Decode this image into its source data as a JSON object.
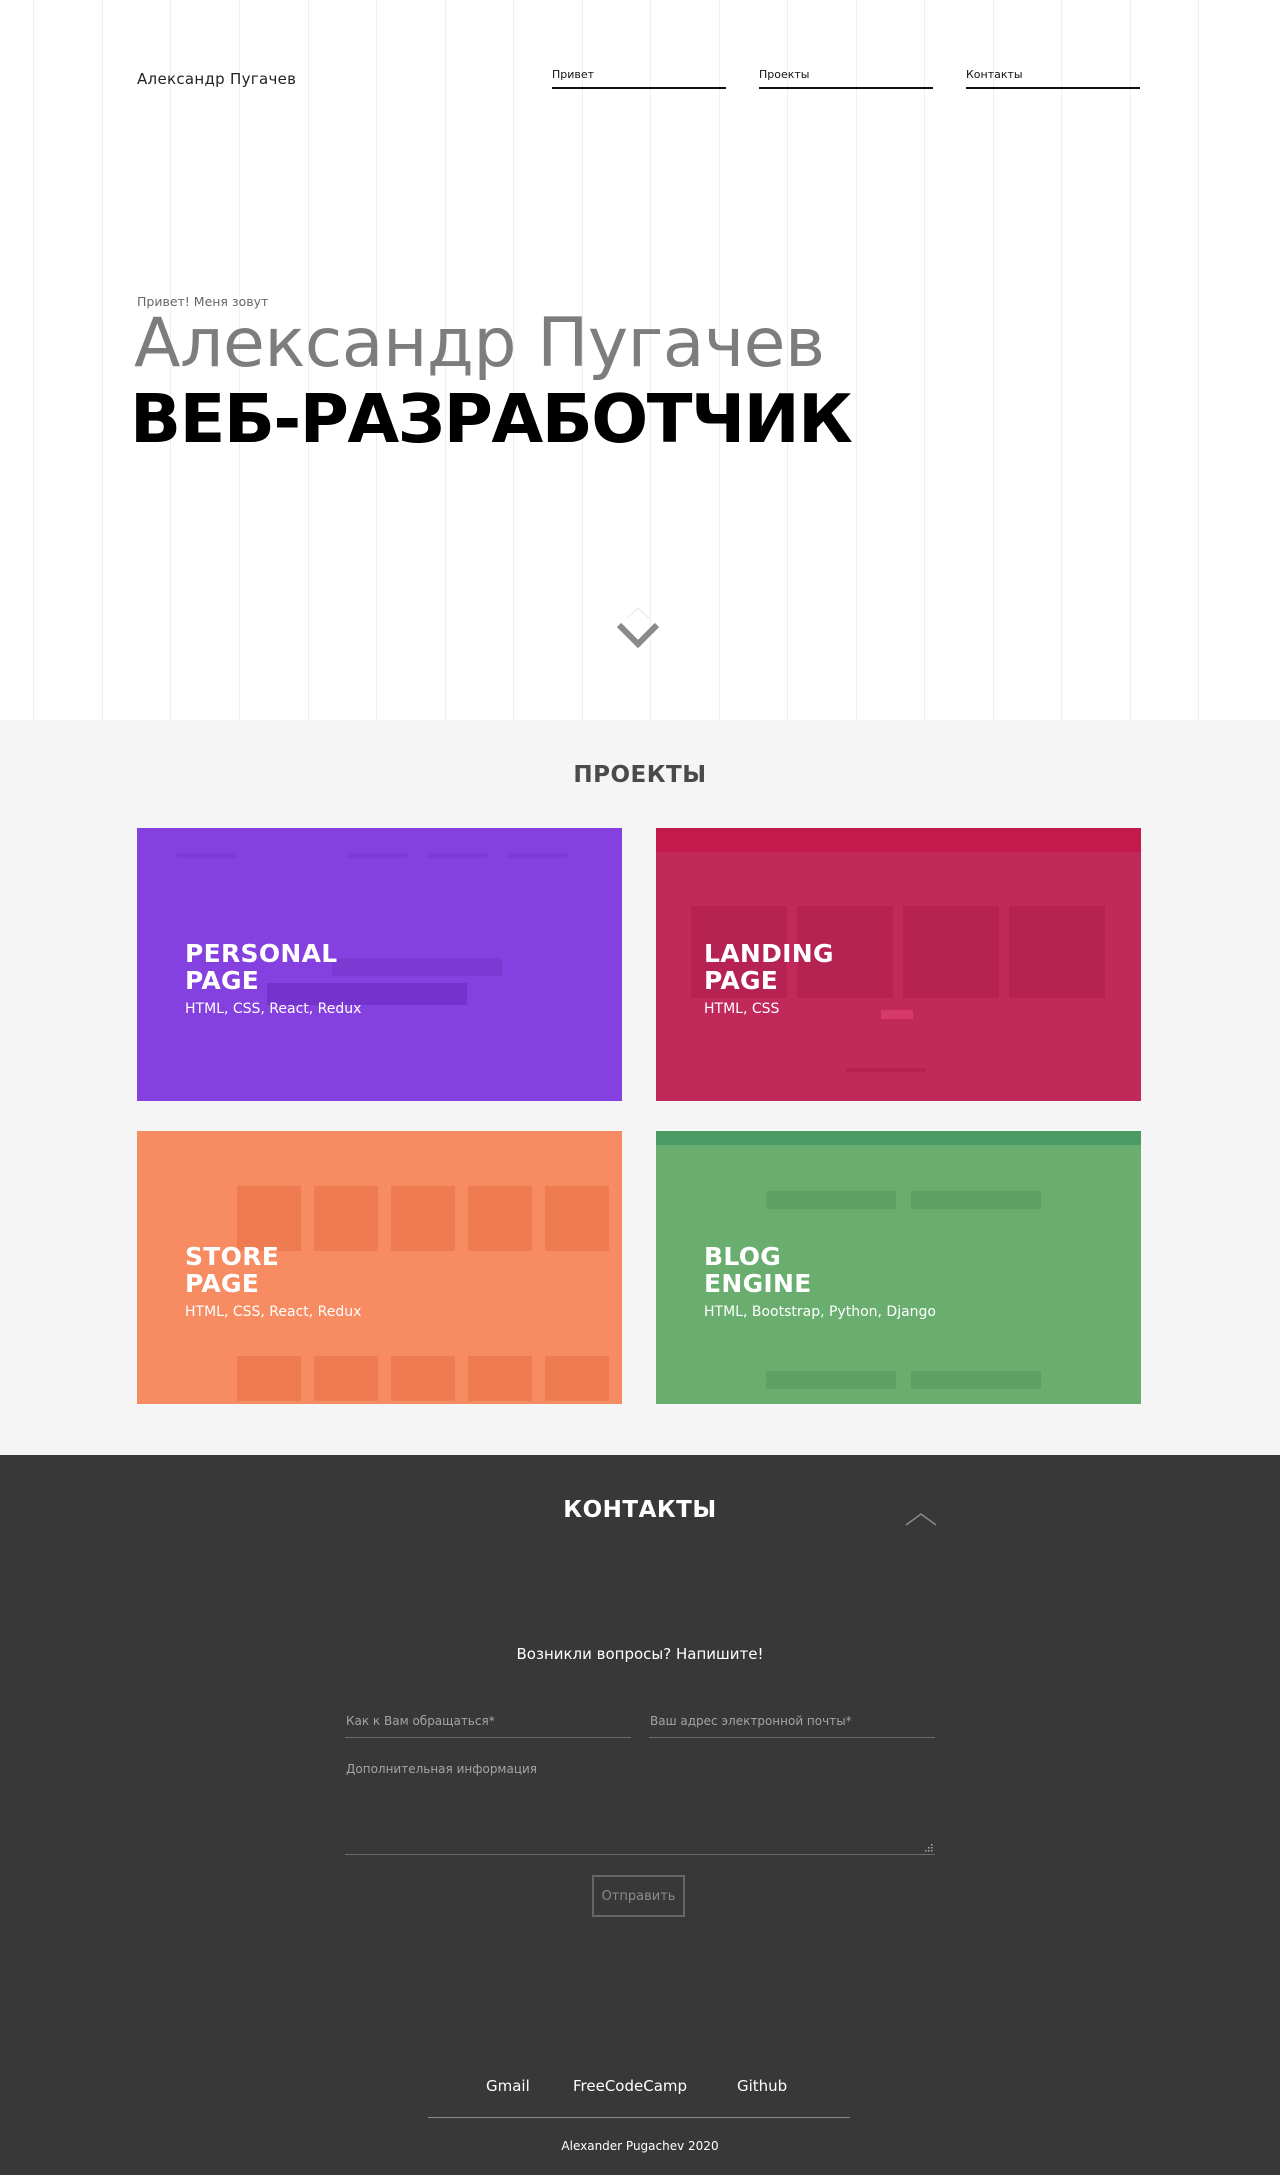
{
  "header": {
    "site_name": "Александр Пугачев",
    "nav": [
      {
        "label": "Привет"
      },
      {
        "label": "Проекты"
      },
      {
        "label": "Контакты"
      }
    ]
  },
  "hero": {
    "greeting": "Привет! Меня зовут",
    "name": "Александр Пугачев",
    "role": "ВЕБ-РАЗРАБОТЧИК",
    "scroll_icon": "chevron-down-icon"
  },
  "projects": {
    "title": "ПРОЕКТЫ",
    "items": [
      {
        "title_line1": "PERSONAL",
        "title_line2": "PAGE",
        "tech": "HTML, CSS, React, Redux",
        "color": "#8540e0"
      },
      {
        "title_line1": "LANDING",
        "title_line2": "PAGE",
        "tech": "HTML, CSS",
        "color": "#c0295a"
      },
      {
        "title_line1": "STORE",
        "title_line2": "PAGE",
        "tech": "HTML, CSS, React, Redux",
        "color": "#f78c62"
      },
      {
        "title_line1": "BLOG",
        "title_line2": "ENGINE",
        "tech": "HTML, Bootstrap, Python, Django",
        "color": "#69ae6e"
      }
    ]
  },
  "contacts": {
    "title": "КОНТАКТЫ",
    "scroll_up_icon": "chevron-up-icon",
    "prompt": "Возникли вопросы? Напишите!",
    "form": {
      "name_placeholder": "Как к Вам обращаться*",
      "email_placeholder": "Ваш адрес электронной почты*",
      "info_placeholder": "Дополнительная информация",
      "submit_label": "Отправить"
    }
  },
  "footer": {
    "links": [
      {
        "label": "Gmail"
      },
      {
        "label": "FreeCodeCamp"
      },
      {
        "label": "Github"
      }
    ],
    "copyright": "Alexander Pugachev 2020"
  },
  "colors": {
    "projects_bg": "#f5f5f5",
    "contacts_bg": "#383838",
    "hero_name": "#7d7d7d"
  }
}
